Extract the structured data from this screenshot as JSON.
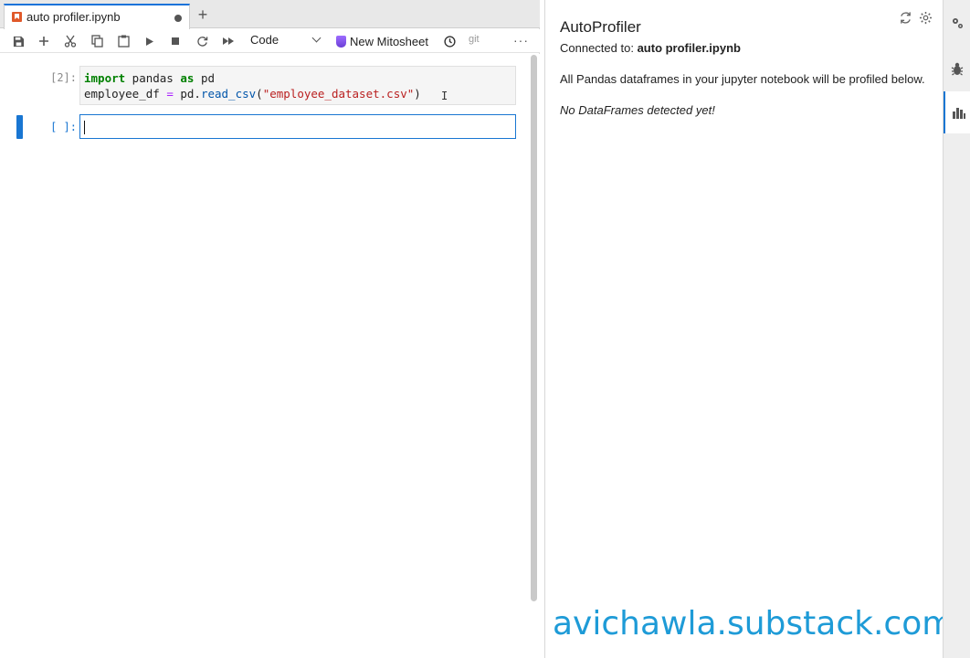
{
  "tab": {
    "label": "auto profiler.ipynb",
    "add_label": "+"
  },
  "toolbar": {
    "kernel_mode": "Code",
    "mitosheet_label": "New Mitosheet",
    "git_label": "git",
    "more_label": "···"
  },
  "cells": [
    {
      "prompt": "[2]:",
      "lines": [
        "import pandas as pd",
        "employee_df = pd.read_csv(\"employee_dataset.csv\")"
      ]
    },
    {
      "prompt": "[ ]:",
      "lines": [
        ""
      ]
    }
  ],
  "side_panel": {
    "title": "AutoProfiler",
    "connected_prefix": "Connected to: ",
    "connected_file": "auto profiler.ipynb",
    "description": "All Pandas dataframes in your jupyter notebook will be profiled below.",
    "empty_state": "No DataFrames detected yet!"
  },
  "watermark": "avichawla.substack.com",
  "icons": {
    "save": "save-icon",
    "add": "plus-icon",
    "cut": "scissors-icon",
    "copy": "copy-icon",
    "paste": "clipboard-icon",
    "run": "play-icon",
    "stop": "stop-icon",
    "restart": "refresh-icon",
    "run_all": "fast-forward-icon",
    "history": "clock-icon"
  },
  "colors": {
    "accent": "#1976d2",
    "watermark": "#1e9bd7",
    "notebook_icon": "#e0592a"
  }
}
